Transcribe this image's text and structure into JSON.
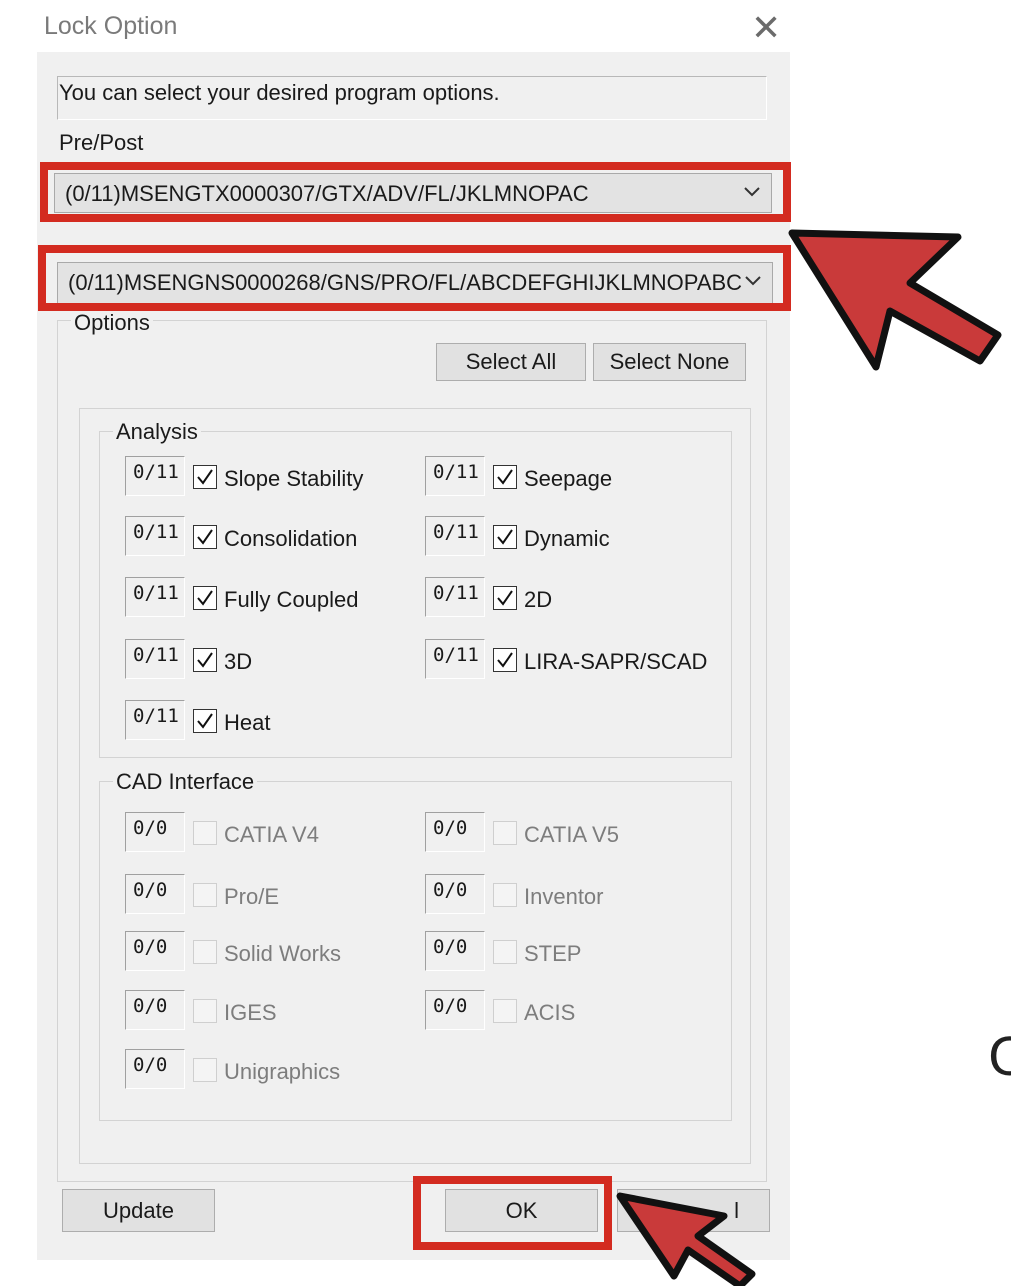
{
  "dialog": {
    "title": "Lock Option",
    "close_glyph": "✕",
    "info_text": "You can select your desired program options.",
    "prepost_label": "Pre/Post",
    "prepost_value": "(0/11)MSENGTX0000307/GTX/ADV/FL/JKLMNOPAC",
    "solver_value": "(0/11)MSENGNS0000268/GNS/PRO/FL/ABCDEFGHIJKLMNOPABC",
    "options_title": "Options",
    "select_all": "Select All",
    "select_none": "Select None",
    "analysis_title": "Analysis",
    "analysis": [
      {
        "count": "0/11",
        "label": "Slope Stability",
        "checked": true
      },
      {
        "count": "0/11",
        "label": "Seepage",
        "checked": true
      },
      {
        "count": "0/11",
        "label": "Consolidation",
        "checked": true
      },
      {
        "count": "0/11",
        "label": "Dynamic",
        "checked": true
      },
      {
        "count": "0/11",
        "label": "Fully Coupled",
        "checked": true
      },
      {
        "count": "0/11",
        "label": "2D",
        "checked": true
      },
      {
        "count": "0/11",
        "label": "3D",
        "checked": true
      },
      {
        "count": "0/11",
        "label": "LIRA-SAPR/SCAD",
        "checked": true
      },
      {
        "count": "0/11",
        "label": "Heat",
        "checked": true
      }
    ],
    "cad_title": "CAD Interface",
    "cad": [
      {
        "count": "0/0",
        "label": "CATIA V4",
        "checked": false
      },
      {
        "count": "0/0",
        "label": "CATIA V5",
        "checked": false
      },
      {
        "count": "0/0",
        "label": "Pro/E",
        "checked": false
      },
      {
        "count": "0/0",
        "label": "Inventor",
        "checked": false
      },
      {
        "count": "0/0",
        "label": "Solid Works",
        "checked": false
      },
      {
        "count": "0/0",
        "label": "STEP",
        "checked": false
      },
      {
        "count": "0/0",
        "label": "IGES",
        "checked": false
      },
      {
        "count": "0/0",
        "label": "ACIS",
        "checked": false
      },
      {
        "count": "0/0",
        "label": "Unigraphics",
        "checked": false
      }
    ],
    "update_button": "Update",
    "ok_button": "OK",
    "cancel_button_partial": "l"
  },
  "outside_text": "C",
  "colors": {
    "highlight_red": "#d32b20",
    "arrow_fill": "#c93a3a",
    "dialog_bg": "#f0f0f0"
  }
}
